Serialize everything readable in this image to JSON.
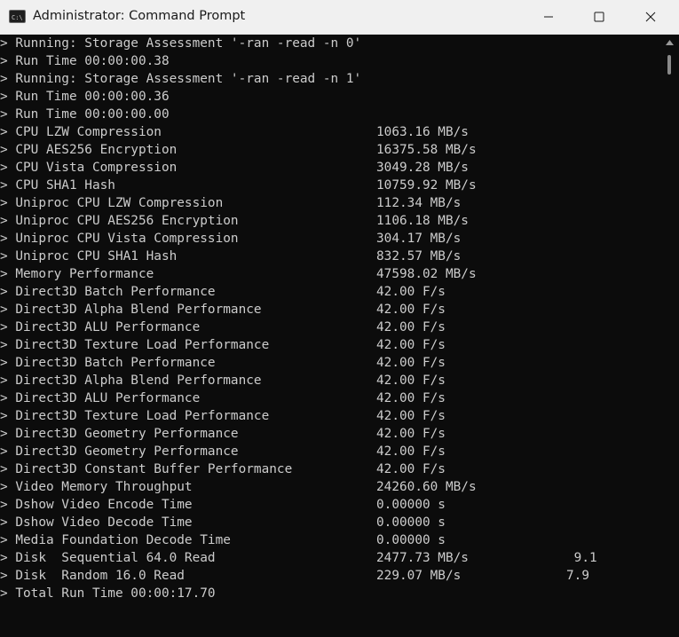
{
  "window": {
    "title": "Administrator: Command Prompt"
  },
  "colors": {
    "console_bg": "#0c0c0c",
    "console_text": "#cccccc",
    "titlebar_bg": "#f0f0f0"
  },
  "icons": {
    "app": "command-prompt-icon",
    "minimize": "minimize-icon",
    "maximize": "maximize-icon",
    "close": "close-icon"
  },
  "console": {
    "lines": [
      {
        "text": "> Running: Storage Assessment '-ran -read -n 0'",
        "value": "",
        "extra": ""
      },
      {
        "text": "> Run Time 00:00:00.38",
        "value": "",
        "extra": ""
      },
      {
        "text": "> Running: Storage Assessment '-ran -read -n 1'",
        "value": "",
        "extra": ""
      },
      {
        "text": "> Run Time 00:00:00.36",
        "value": "",
        "extra": ""
      },
      {
        "text": "> Run Time 00:00:00.00",
        "value": "",
        "extra": ""
      },
      {
        "text": "> CPU LZW Compression",
        "value": "1063.16 MB/s",
        "extra": ""
      },
      {
        "text": "> CPU AES256 Encryption",
        "value": "16375.58 MB/s",
        "extra": ""
      },
      {
        "text": "> CPU Vista Compression",
        "value": "3049.28 MB/s",
        "extra": ""
      },
      {
        "text": "> CPU SHA1 Hash",
        "value": "10759.92 MB/s",
        "extra": ""
      },
      {
        "text": "> Uniproc CPU LZW Compression",
        "value": "112.34 MB/s",
        "extra": ""
      },
      {
        "text": "> Uniproc CPU AES256 Encryption",
        "value": "1106.18 MB/s",
        "extra": ""
      },
      {
        "text": "> Uniproc CPU Vista Compression",
        "value": "304.17 MB/s",
        "extra": ""
      },
      {
        "text": "> Uniproc CPU SHA1 Hash",
        "value": "832.57 MB/s",
        "extra": ""
      },
      {
        "text": "> Memory Performance",
        "value": "47598.02 MB/s",
        "extra": ""
      },
      {
        "text": "> Direct3D Batch Performance",
        "value": "42.00 F/s",
        "extra": ""
      },
      {
        "text": "> Direct3D Alpha Blend Performance",
        "value": "42.00 F/s",
        "extra": ""
      },
      {
        "text": "> Direct3D ALU Performance",
        "value": "42.00 F/s",
        "extra": ""
      },
      {
        "text": "> Direct3D Texture Load Performance",
        "value": "42.00 F/s",
        "extra": ""
      },
      {
        "text": "> Direct3D Batch Performance",
        "value": "42.00 F/s",
        "extra": ""
      },
      {
        "text": "> Direct3D Alpha Blend Performance",
        "value": "42.00 F/s",
        "extra": ""
      },
      {
        "text": "> Direct3D ALU Performance",
        "value": "42.00 F/s",
        "extra": ""
      },
      {
        "text": "> Direct3D Texture Load Performance",
        "value": "42.00 F/s",
        "extra": ""
      },
      {
        "text": "> Direct3D Geometry Performance",
        "value": "42.00 F/s",
        "extra": ""
      },
      {
        "text": "> Direct3D Geometry Performance",
        "value": "42.00 F/s",
        "extra": ""
      },
      {
        "text": "> Direct3D Constant Buffer Performance",
        "value": "42.00 F/s",
        "extra": ""
      },
      {
        "text": "> Video Memory Throughput",
        "value": "24260.60 MB/s",
        "extra": ""
      },
      {
        "text": "> Dshow Video Encode Time",
        "value": "0.00000 s",
        "extra": ""
      },
      {
        "text": "> Dshow Video Decode Time",
        "value": "0.00000 s",
        "extra": ""
      },
      {
        "text": "> Media Foundation Decode Time",
        "value": "0.00000 s",
        "extra": ""
      },
      {
        "text": "> Disk  Sequential 64.0 Read",
        "value": "2477.73 MB/s",
        "extra": "    9.1"
      },
      {
        "text": "> Disk  Random 16.0 Read",
        "value": "229.07 MB/s",
        "extra": "   7.9"
      },
      {
        "text": "> Total Run Time 00:00:17.70",
        "value": "",
        "extra": ""
      }
    ]
  }
}
